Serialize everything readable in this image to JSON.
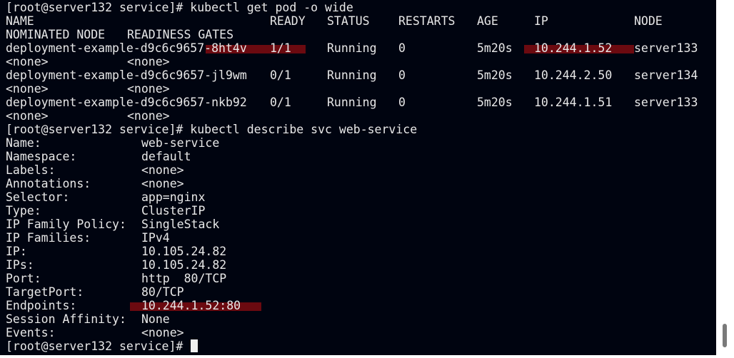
{
  "terminal": {
    "prompt": "[root@server132 service]# ",
    "command1": "kubectl get pod -o wide",
    "command2": "kubectl describe svc web-service",
    "headers": {
      "name": "NAME",
      "ready": "READY",
      "status": "STATUS",
      "restarts": "RESTARTS",
      "age": "AGE",
      "ip": "IP",
      "node": "NODE",
      "nominated_node": "NOMINATED NODE",
      "readiness_gates": "READINESS GATES"
    },
    "pods": [
      {
        "name_prefix": "deployment-example-d9c6c9657",
        "name_suffix": "-8ht4v",
        "ready": "1/1",
        "status": "Running",
        "restarts": "0",
        "age": "5m20s",
        "ip": "10.244.1.52",
        "node": "server133",
        "nominated_node": "<none>",
        "readiness_gates": "<none>",
        "highlighted": true
      },
      {
        "name_prefix": "deployment-example-d9c6c9657",
        "name_suffix": "-jl9wm",
        "ready": "0/1",
        "status": "Running",
        "restarts": "0",
        "age": "5m20s",
        "ip": "10.244.2.50",
        "node": "server134",
        "nominated_node": "<none>",
        "readiness_gates": "<none>",
        "highlighted": false
      },
      {
        "name_prefix": "deployment-example-d9c6c9657",
        "name_suffix": "-nkb92",
        "ready": "0/1",
        "status": "Running",
        "restarts": "0",
        "age": "5m20s",
        "ip": "10.244.1.51",
        "node": "server133",
        "nominated_node": "<none>",
        "readiness_gates": "<none>",
        "highlighted": false
      }
    ],
    "describe": [
      {
        "key": "Name:",
        "value": "web-service"
      },
      {
        "key": "Namespace:",
        "value": "default"
      },
      {
        "key": "Labels:",
        "value": "<none>"
      },
      {
        "key": "Annotations:",
        "value": "<none>"
      },
      {
        "key": "Selector:",
        "value": "app=nginx"
      },
      {
        "key": "Type:",
        "value": "ClusterIP"
      },
      {
        "key": "IP Family Policy:",
        "value": "SingleStack"
      },
      {
        "key": "IP Families:",
        "value": "IPv4"
      },
      {
        "key": "IP:",
        "value": "10.105.24.82"
      },
      {
        "key": "IPs:",
        "value": "10.105.24.82"
      },
      {
        "key": "Port:",
        "value": "http  80/TCP"
      },
      {
        "key": "TargetPort:",
        "value": "80/TCP"
      },
      {
        "key": "Endpoints:",
        "value": "10.244.1.52:80",
        "highlighted": true
      },
      {
        "key": "Session Affinity:",
        "value": "None"
      },
      {
        "key": "Events:",
        "value": "<none>"
      }
    ]
  },
  "colors": {
    "background": "#000410",
    "text": "#e8e8e8",
    "highlight": "#6b0a10",
    "scrollbar_thumb": "#7a7a7a"
  }
}
